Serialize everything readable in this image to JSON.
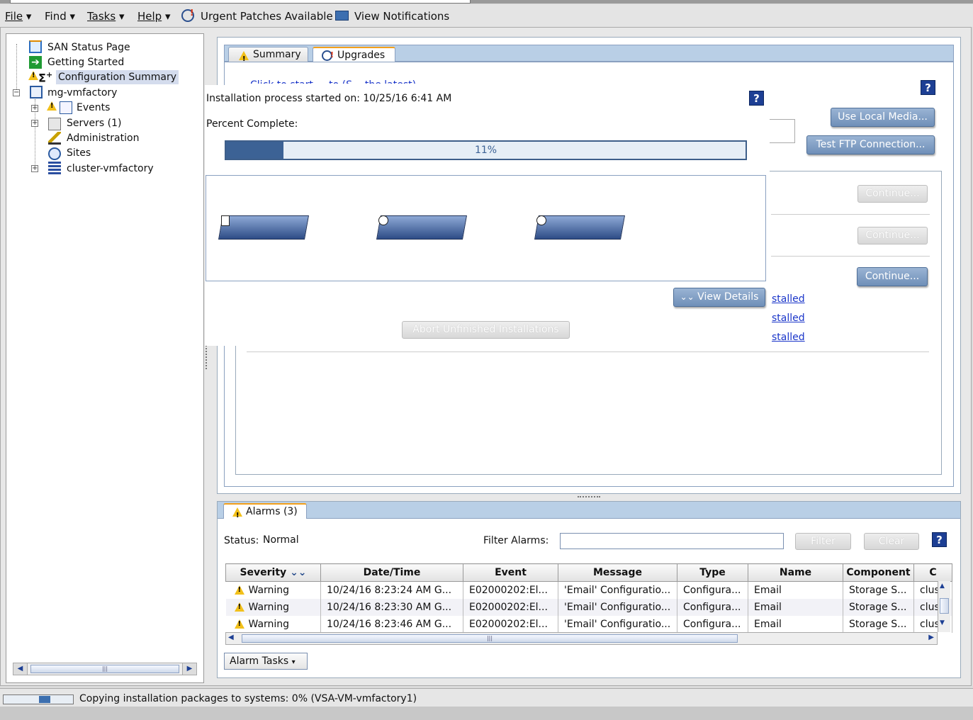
{
  "menu": {
    "file": "File",
    "find": "Find",
    "tasks": "Tasks",
    "help": "Help",
    "urgent": "Urgent Patches Available",
    "notifications": "View Notifications"
  },
  "tree": {
    "items": [
      {
        "label": "SAN Status Page"
      },
      {
        "label": "Getting Started"
      },
      {
        "label": "Configuration Summary"
      },
      {
        "label": "mg-vmfactory"
      },
      {
        "label": "Events"
      },
      {
        "label": "Servers (1)"
      },
      {
        "label": "Administration"
      },
      {
        "label": "Sites"
      },
      {
        "label": "cluster-vmfactory"
      }
    ]
  },
  "tabs": {
    "summary": "Summary",
    "upgrades": "Upgrades"
  },
  "upgrades": {
    "use_local_media": "Use Local Media...",
    "test_ftp": "Test FTP Connection...",
    "continue": "Continue...",
    "installed_link": "stalled",
    "truncated_link": "Click to start ... to (S... the latest)"
  },
  "install_dialog": {
    "started": "Installation process started on: 10/25/16 6:41 AM",
    "percent_label": "Percent Complete:",
    "progress_text": "11%",
    "progress_value": 0.11,
    "view_details": "View Details",
    "abort": "Abort Unfinished Installations",
    "help": "?"
  },
  "alarms": {
    "tab_label": "Alarms (3)",
    "status_label": "Status:",
    "status_value": "Normal",
    "filter_label": "Filter Alarms:",
    "filter_value": "",
    "filter_button": "Filter",
    "clear_button": "Clear",
    "help": "?",
    "columns": [
      "Severity",
      "Date/Time",
      "Event",
      "Message",
      "Type",
      "Name",
      "Component",
      "C"
    ],
    "rows": [
      [
        "Warning",
        "10/24/16 8:23:24 AM G...",
        "E02000202:El...",
        "'Email' Configuratio...",
        "Configura...",
        "Email",
        "Storage S...",
        "clus"
      ],
      [
        "Warning",
        "10/24/16 8:23:30 AM G...",
        "E02000202:El...",
        "'Email' Configuratio...",
        "Configura...",
        "Email",
        "Storage S...",
        "clus"
      ],
      [
        "Warning",
        "10/24/16 8:23:46 AM G...",
        "E02000202:El...",
        "'Email' Configuratio...",
        "Configura...",
        "Email",
        "Storage S...",
        "clus"
      ]
    ],
    "tasks_button": "Alarm Tasks"
  },
  "status_bar": {
    "text": "Copying installation packages to systems: 0% (VSA-VM-vmfactory1)"
  },
  "colors": {
    "accent": "#3a5f8f",
    "tab_bar": "#b9cfe6",
    "help_blue": "#1d3f94"
  }
}
